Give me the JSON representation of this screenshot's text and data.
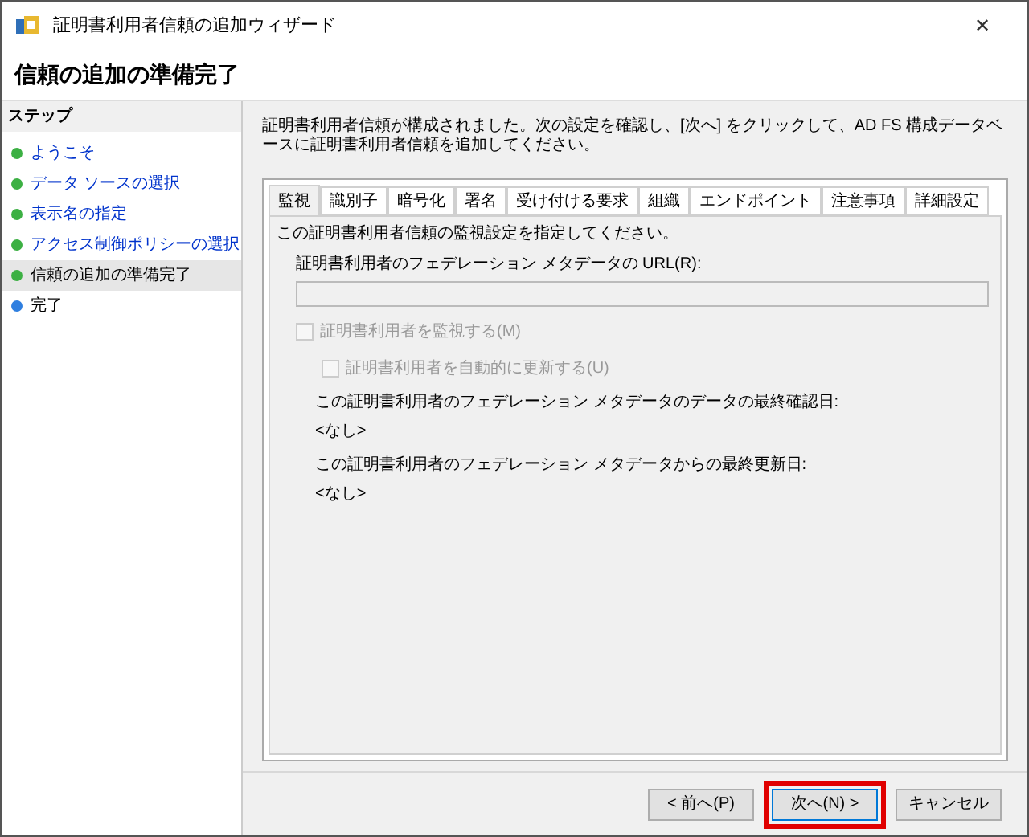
{
  "window": {
    "title": "証明書利用者信頼の追加ウィザード",
    "close": "✕"
  },
  "header": {
    "title": "信頼の追加の準備完了"
  },
  "steps": {
    "heading": "ステップ",
    "items": [
      {
        "label": "ようこそ",
        "color": "#3cb043",
        "link": true,
        "selected": false
      },
      {
        "label": "データ ソースの選択",
        "color": "#3cb043",
        "link": true,
        "selected": false
      },
      {
        "label": "表示名の指定",
        "color": "#3cb043",
        "link": true,
        "selected": false
      },
      {
        "label": "アクセス制御ポリシーの選択",
        "color": "#3cb043",
        "link": true,
        "selected": false
      },
      {
        "label": "信頼の追加の準備完了",
        "color": "#3cb043",
        "link": false,
        "selected": true
      },
      {
        "label": "完了",
        "color": "#2f7fe0",
        "link": false,
        "selected": false
      }
    ]
  },
  "description": "証明書利用者信頼が構成されました。次の設定を確認し、[次へ] をクリックして、AD FS 構成データベースに証明書利用者信頼を追加してください。",
  "tabs": [
    {
      "label": "監視",
      "selected": true
    },
    {
      "label": "識別子",
      "selected": false
    },
    {
      "label": "暗号化",
      "selected": false
    },
    {
      "label": "署名",
      "selected": false
    },
    {
      "label": "受け付ける要求",
      "selected": false
    },
    {
      "label": "組織",
      "selected": false
    },
    {
      "label": "エンドポイント",
      "selected": false
    },
    {
      "label": "注意事項",
      "selected": false
    },
    {
      "label": "詳細設定",
      "selected": false
    }
  ],
  "monitoring": {
    "intro": "この証明書利用者信頼の監視設定を指定してください。",
    "url_label": "証明書利用者のフェデレーション メタデータの URL(R):",
    "checkboxes": [
      {
        "label": "証明書利用者を監視する(M)",
        "checked": false,
        "disabled": true
      },
      {
        "label": "証明書利用者を自動的に更新する(U)",
        "checked": false,
        "disabled": true
      }
    ],
    "info": [
      {
        "label": "この証明書利用者のフェデレーション メタデータのデータの最終確認日:",
        "value": "<なし>"
      },
      {
        "label": "この証明書利用者のフェデレーション メタデータからの最終更新日:",
        "value": "<なし>"
      }
    ]
  },
  "buttons": [
    {
      "label": "< 前へ(P)",
      "highlighted": false
    },
    {
      "label": "次へ(N) >",
      "highlighted": true
    },
    {
      "label": "キャンセル",
      "highlighted": false
    }
  ]
}
